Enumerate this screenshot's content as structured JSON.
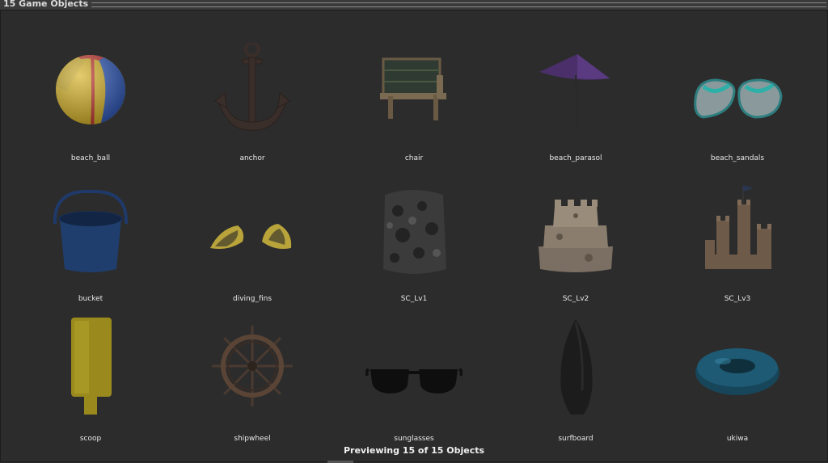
{
  "window": {
    "title": "15 Game Objects"
  },
  "objects": [
    {
      "label": "beach_ball",
      "icon": "beach-ball-icon"
    },
    {
      "label": "anchor",
      "icon": "anchor-icon"
    },
    {
      "label": "chair",
      "icon": "chair-icon"
    },
    {
      "label": "beach_parasol",
      "icon": "parasol-icon"
    },
    {
      "label": "beach_sandals",
      "icon": "sandals-icon"
    },
    {
      "label": "bucket",
      "icon": "bucket-icon"
    },
    {
      "label": "diving_fins",
      "icon": "fins-icon"
    },
    {
      "label": "SC_Lv1",
      "icon": "sandcastle-lv1-icon"
    },
    {
      "label": "SC_Lv2",
      "icon": "sandcastle-lv2-icon"
    },
    {
      "label": "SC_Lv3",
      "icon": "sandcastle-lv3-icon"
    },
    {
      "label": "scoop",
      "icon": "scoop-icon"
    },
    {
      "label": "shipwheel",
      "icon": "shipwheel-icon"
    },
    {
      "label": "sunglasses",
      "icon": "sunglasses-icon"
    },
    {
      "label": "surfboard",
      "icon": "surfboard-icon"
    },
    {
      "label": "ukiwa",
      "icon": "swim-ring-icon"
    }
  ],
  "status": {
    "text": "Previewing 15 of 15 Objects"
  }
}
